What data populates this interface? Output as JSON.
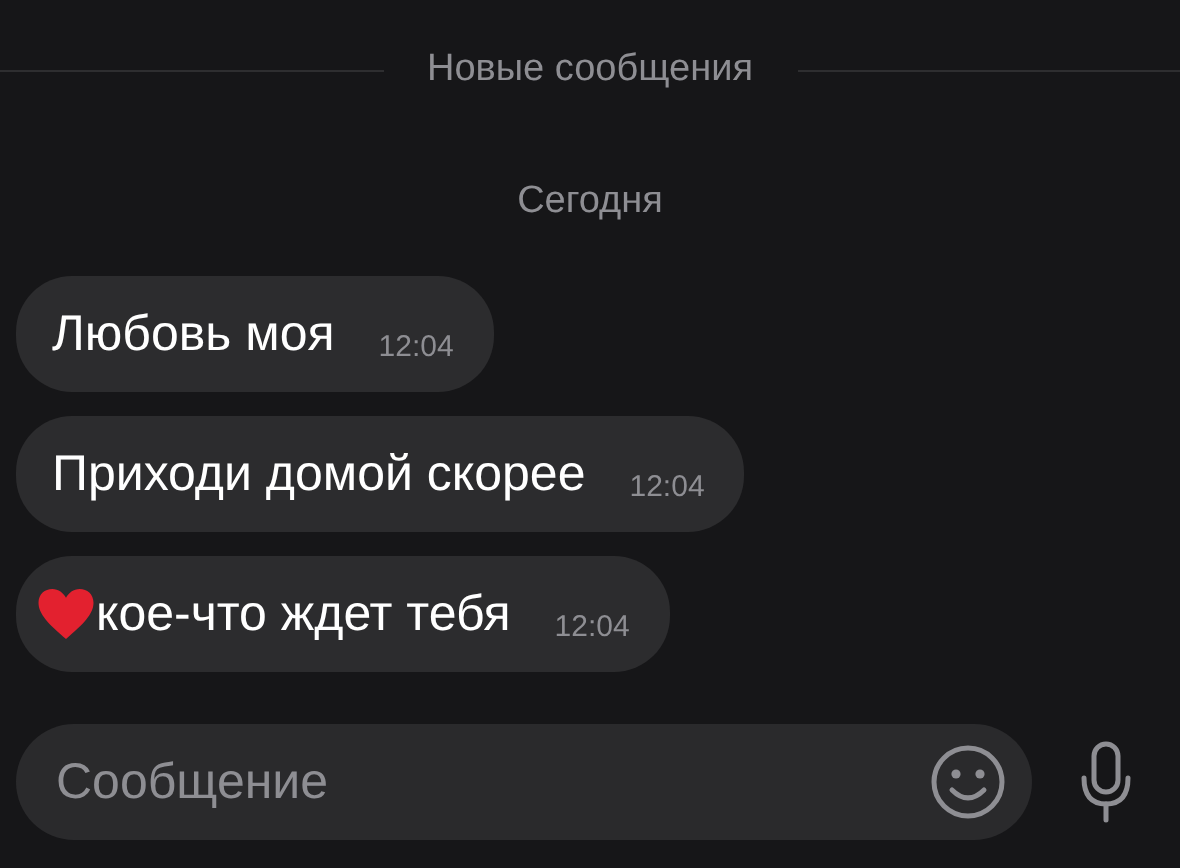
{
  "divider": {
    "label": "Новые сообщения"
  },
  "date": "Сегодня",
  "messages": [
    {
      "kind": "plain",
      "text": "Любовь моя",
      "time": "12:04"
    },
    {
      "kind": "plain",
      "text": "Приходи домой скорее",
      "time": "12:04"
    },
    {
      "kind": "heart",
      "text": "кое-что ждет тебя",
      "time": "12:04"
    }
  ],
  "composer": {
    "placeholder": "Сообщение"
  }
}
